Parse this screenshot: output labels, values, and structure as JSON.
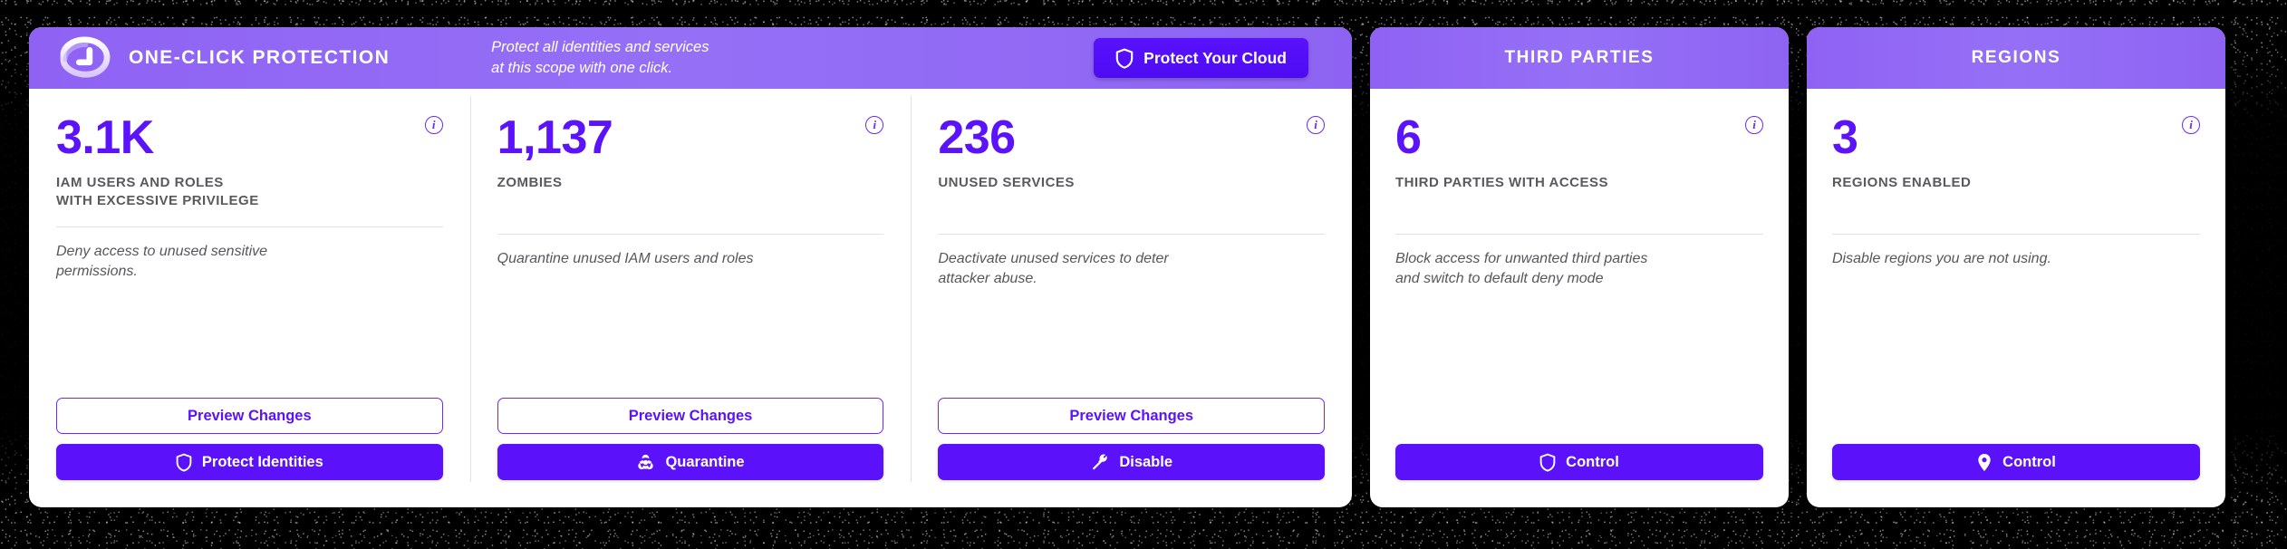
{
  "theme": {
    "accent": "#5B12FB",
    "header_purple": "#9167F5",
    "label_gray": "#5a5a5e",
    "rule_gray": "#e2e2e4",
    "background": "#000000"
  },
  "main_card": {
    "header": {
      "logo_icon": "shield-logo-icon",
      "title": "ONE-CLICK PROTECTION",
      "subtitle": "Protect all identities and services\nat this scope with one click.",
      "cta": {
        "label": "Protect Your Cloud",
        "icon": "shield-icon"
      }
    },
    "columns": [
      {
        "value": "3.1K",
        "label": "IAM USERS AND ROLES\nWITH EXCESSIVE PRIVILEGE",
        "description": "Deny access to unused sensitive\npermissions.",
        "info_icon": "info-icon",
        "secondary_button": {
          "label": "Preview Changes"
        },
        "primary_button": {
          "label": "Protect Identities",
          "icon": "shield-icon"
        }
      },
      {
        "value": "1,137",
        "label": "ZOMBIES",
        "description": "Quarantine unused IAM users and roles",
        "info_icon": "info-icon",
        "secondary_button": {
          "label": "Preview Changes"
        },
        "primary_button": {
          "label": "Quarantine",
          "icon": "biohazard-icon"
        }
      },
      {
        "value": "236",
        "label": "UNUSED SERVICES",
        "description": "Deactivate unused services to deter\nattacker abuse.",
        "info_icon": "info-icon",
        "secondary_button": {
          "label": "Preview Changes"
        },
        "primary_button": {
          "label": "Disable",
          "icon": "tools-icon"
        }
      }
    ]
  },
  "side_cards": [
    {
      "header_title": "THIRD PARTIES",
      "value": "6",
      "label": "THIRD PARTIES WITH ACCESS",
      "description": "Block access for unwanted third parties\nand switch to default deny mode",
      "info_icon": "info-icon",
      "primary_button": {
        "label": "Control",
        "icon": "shield-icon"
      }
    },
    {
      "header_title": "REGIONS",
      "value": "3",
      "label": "REGIONS ENABLED",
      "description": "Disable regions you are not using.",
      "info_icon": "info-icon",
      "primary_button": {
        "label": "Control",
        "icon": "location-pin-icon"
      }
    }
  ],
  "icons": {
    "info_glyph": "i"
  }
}
